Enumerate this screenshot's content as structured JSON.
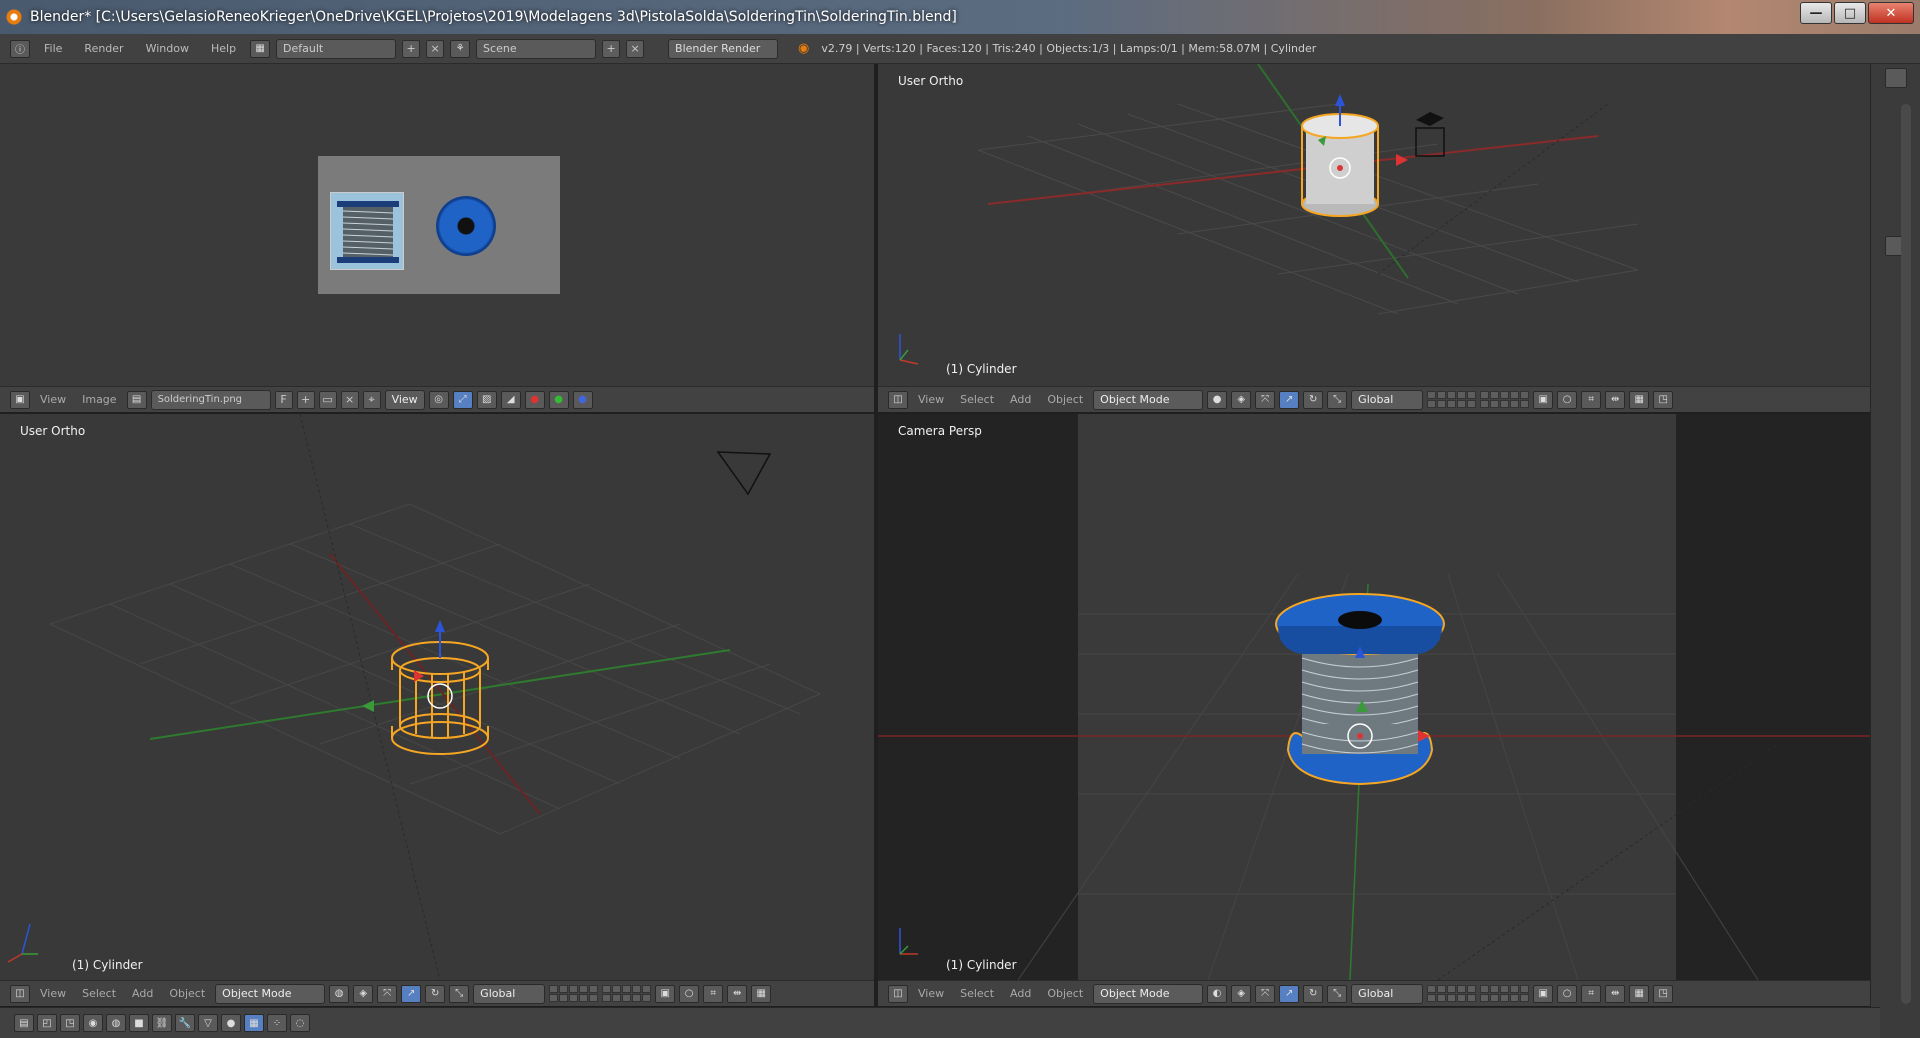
{
  "window": {
    "title": "Blender* [C:\\Users\\GelasioReneoKrieger\\OneDrive\\KGEL\\Projetos\\2019\\Modelagens 3d\\PistolaSolda\\SolderingTin\\SolderingTin.blend]",
    "minimize": "—",
    "maximize": "□",
    "close": "✕"
  },
  "infobar": {
    "menus": [
      "File",
      "Render",
      "Window",
      "Help"
    ],
    "layout": "Default",
    "scene": "Scene",
    "engine": "Blender Render",
    "stats": "v2.79 | Verts:120 | Faces:120 | Tris:240 | Objects:1/3 | Lamps:0/1 | Mem:58.07M | Cylinder"
  },
  "uv_editor": {
    "menus": [
      "View",
      "Image"
    ],
    "image_name": "SolderingTin.png",
    "image_flag": "F",
    "view_label": "View"
  },
  "viewport_top_right": {
    "label": "User Ortho",
    "object": "(1) Cylinder"
  },
  "viewport_bottom_left": {
    "label": "User Ortho",
    "object": "(1) Cylinder"
  },
  "viewport_bottom_right": {
    "label": "Camera Persp",
    "object": "(1) Cylinder"
  },
  "view3d_header": {
    "menus": [
      "View",
      "Select",
      "Add",
      "Object"
    ],
    "mode": "Object Mode",
    "orientation": "Global"
  },
  "colors": {
    "accent": "#e87d0d",
    "selection": "#f5a623",
    "spool_blue": "#1f63c7",
    "x_axis": "#c0392b",
    "y_axis": "#3a9a3a",
    "z_axis": "#2a55d8"
  }
}
